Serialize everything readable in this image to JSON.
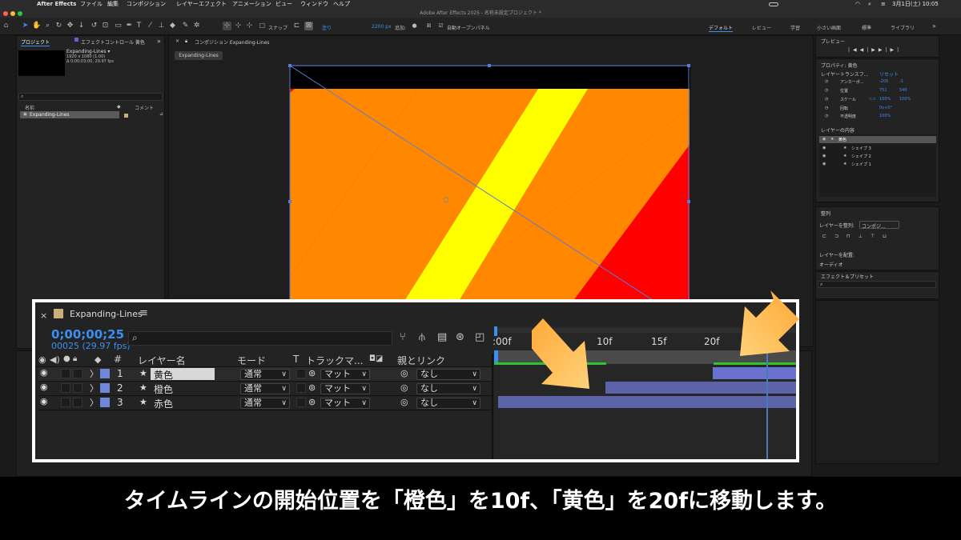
{
  "menubar": {
    "app": "After Effects",
    "items": [
      "ファイル",
      "編集",
      "コンポジション",
      "レイヤー",
      "エフェクト",
      "アニメーション",
      "ビュー",
      "ウィンドウ",
      "ヘルプ"
    ],
    "clock": "3月1日(土) 10:05"
  },
  "window_title": "Adobe After Effects 2025 - 名称未設定プロジェクト *",
  "toolbar": {
    "snap": "スナップ",
    "fill": "塗り",
    "stroke_px": "2200 px",
    "add": "追加:",
    "auto_open": "自動オープンパネル",
    "workspaces": [
      "デフォルト",
      "レビュー",
      "学習",
      "小さい画面",
      "標準",
      "ライブラリ"
    ]
  },
  "project_panel": {
    "tab1": "プロジェクト",
    "tab2": "エフェクトコントロール 黄色",
    "comp_name": "Expanding-Lines ▾",
    "comp_info1": "1920 x 1080 (1.00)",
    "comp_info2": "Δ 0;00;03;00, 29.97 fps",
    "search_placeholder": "",
    "col_name": "名前",
    "col_comment": "コメント",
    "item": "Expanding-Lines"
  },
  "comp_viewer": {
    "title": "コンポジション Expanding-Lines",
    "tab": "Expanding-Lines"
  },
  "right_panel": {
    "preview_title": "プレビュー",
    "properties_title": "プロパティ: 黄色",
    "layer_transform": "レイヤートランスフ...",
    "reset": "リセット",
    "props": [
      {
        "name": "アンカーポ...",
        "v1": "-205",
        "v2": "-1"
      },
      {
        "name": "位置",
        "v1": "751",
        "v2": "540"
      },
      {
        "name": "スケール",
        "v1": "100%",
        "v2": "100%"
      },
      {
        "name": "回転",
        "v1": "0x+0°",
        "v2": ""
      },
      {
        "name": "不透明度",
        "v1": "100%",
        "v2": ""
      }
    ],
    "layer_contents": "レイヤーの内容",
    "contents": [
      "黄色",
      "シェイプ 3",
      "シェイプ 2",
      "シェイプ 1"
    ],
    "align_title": "整列",
    "align_to": "レイヤーを整列:",
    "align_target": "コンポジ...",
    "distribute": "レイヤーを配置:",
    "audio": "オーディオ",
    "effects_title": "エフェクト＆プリセット"
  },
  "timeline": {
    "comp_tab": "Expanding-Lines",
    "timecode": "0;00;00;25",
    "frames": "00025 (29.97 fps)",
    "search_placeholder": "",
    "col_layer_name": "レイヤー名",
    "col_mode": "モード",
    "col_t": "T",
    "col_track": "トラックマ...",
    "col_parent": "親とリンク",
    "col_num": "#",
    "ticks": [
      ":00f",
      "10f",
      "15f",
      "20f",
      "f"
    ],
    "layers": [
      {
        "num": "1",
        "name": "黄色",
        "mode": "通常",
        "matte": "マット",
        "parent": "なし"
      },
      {
        "num": "2",
        "name": "橙色",
        "mode": "通常",
        "matte": "マット",
        "parent": "なし"
      },
      {
        "num": "3",
        "name": "赤色",
        "mode": "通常",
        "matte": "マット",
        "parent": "なし"
      }
    ],
    "layer_bar_starts_frames": [
      20,
      10,
      0
    ]
  },
  "caption": "タイムラインの開始位置を「橙色」を10f、「黄色」を20fに移動します。",
  "colors": {
    "red": "#ff0000",
    "orange": "#ff8800",
    "yellow": "#ffff00",
    "accent_blue": "#3b8ff0",
    "label_blue": "#6e86dc",
    "arrow": "#ffb347"
  }
}
